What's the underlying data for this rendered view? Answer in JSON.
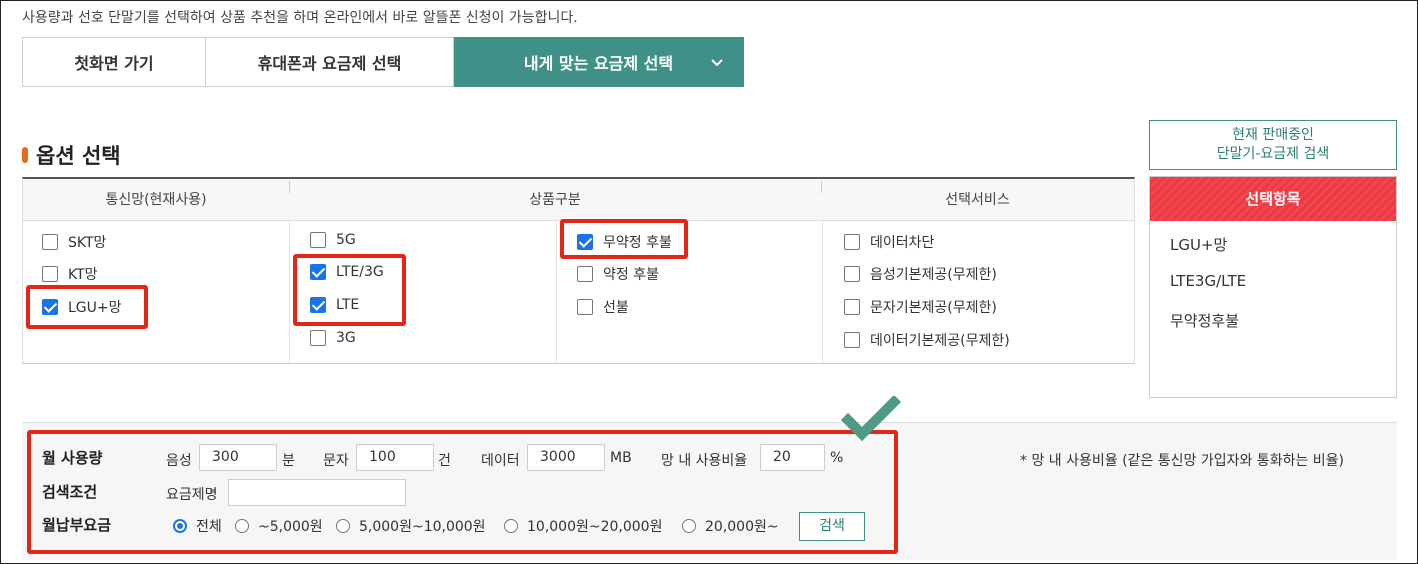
{
  "intro_text": "사용량과 선호 단말기를 선택하여 상품 추천을 하며 온라인에서 바로 알뜰폰 신청이 가능합니다.",
  "tabs": [
    {
      "label": "첫화면 가기",
      "active": false
    },
    {
      "label": "휴대폰과 요금제 선택",
      "active": false
    },
    {
      "label": "내게 맞는 요금제 선택",
      "active": true,
      "icon": "chevron-down-icon"
    }
  ],
  "option_section": {
    "title": "옵션 선택",
    "headers": {
      "network": "통신망(현재사용)",
      "product": "상품구분",
      "service": "선택서비스"
    },
    "network_options": [
      {
        "label": "SKT망",
        "checked": false
      },
      {
        "label": "KT망",
        "checked": false
      },
      {
        "label": "LGU+망",
        "checked": true
      }
    ],
    "tech_options": [
      {
        "label": "5G",
        "checked": false
      },
      {
        "label": "LTE/3G",
        "checked": true
      },
      {
        "label": "LTE",
        "checked": true
      },
      {
        "label": "3G",
        "checked": false
      }
    ],
    "contract_options": [
      {
        "label": "무약정 후불",
        "checked": true
      },
      {
        "label": "약정 후불",
        "checked": false
      },
      {
        "label": "선불",
        "checked": false
      }
    ],
    "service_options": [
      {
        "label": "데이터차단",
        "checked": false
      },
      {
        "label": "음성기본제공(무제한)",
        "checked": false
      },
      {
        "label": "문자기본제공(무제한)",
        "checked": false
      },
      {
        "label": "데이터기본제공(무제한)",
        "checked": false
      }
    ]
  },
  "search_now_button": {
    "line1": "현재 판매중인",
    "line2": "단말기-요금제 검색"
  },
  "selected_panel": {
    "title": "선택항목",
    "items": [
      "LGU+망",
      "LTE3G/LTE",
      "무약정후불"
    ]
  },
  "conditions": {
    "monthly_usage_label": "월 사용량",
    "voice_label": "음성",
    "voice_value": "300",
    "voice_unit": "분",
    "sms_label": "문자",
    "sms_value": "100",
    "sms_unit": "건",
    "data_label": "데이터",
    "data_value": "3000",
    "data_unit": "MB",
    "onnet_label": "망 내 사용비율",
    "onnet_value": "20",
    "onnet_unit": "%",
    "note": "* 망 내 사용비율 (같은 통신망 가입자와 통화하는 비율)",
    "search_cond_label": "검색조건",
    "plan_name_label": "요금제명",
    "plan_name_value": "",
    "monthly_fee_label": "월납부요금",
    "fee_options": [
      {
        "label": "전체",
        "selected": true
      },
      {
        "label": "~5,000원",
        "selected": false
      },
      {
        "label": "5,000원~10,000원",
        "selected": false
      },
      {
        "label": "10,000원~20,000원",
        "selected": false
      },
      {
        "label": "20,000원~",
        "selected": false
      }
    ],
    "search_button": "검색"
  },
  "colors": {
    "accent_teal": "#3f9087",
    "highlight_red": "#e1261c",
    "selected_header": "#f2464f",
    "checkbox_blue": "#1a73e8",
    "checkmark_green": "#4f9a84"
  }
}
